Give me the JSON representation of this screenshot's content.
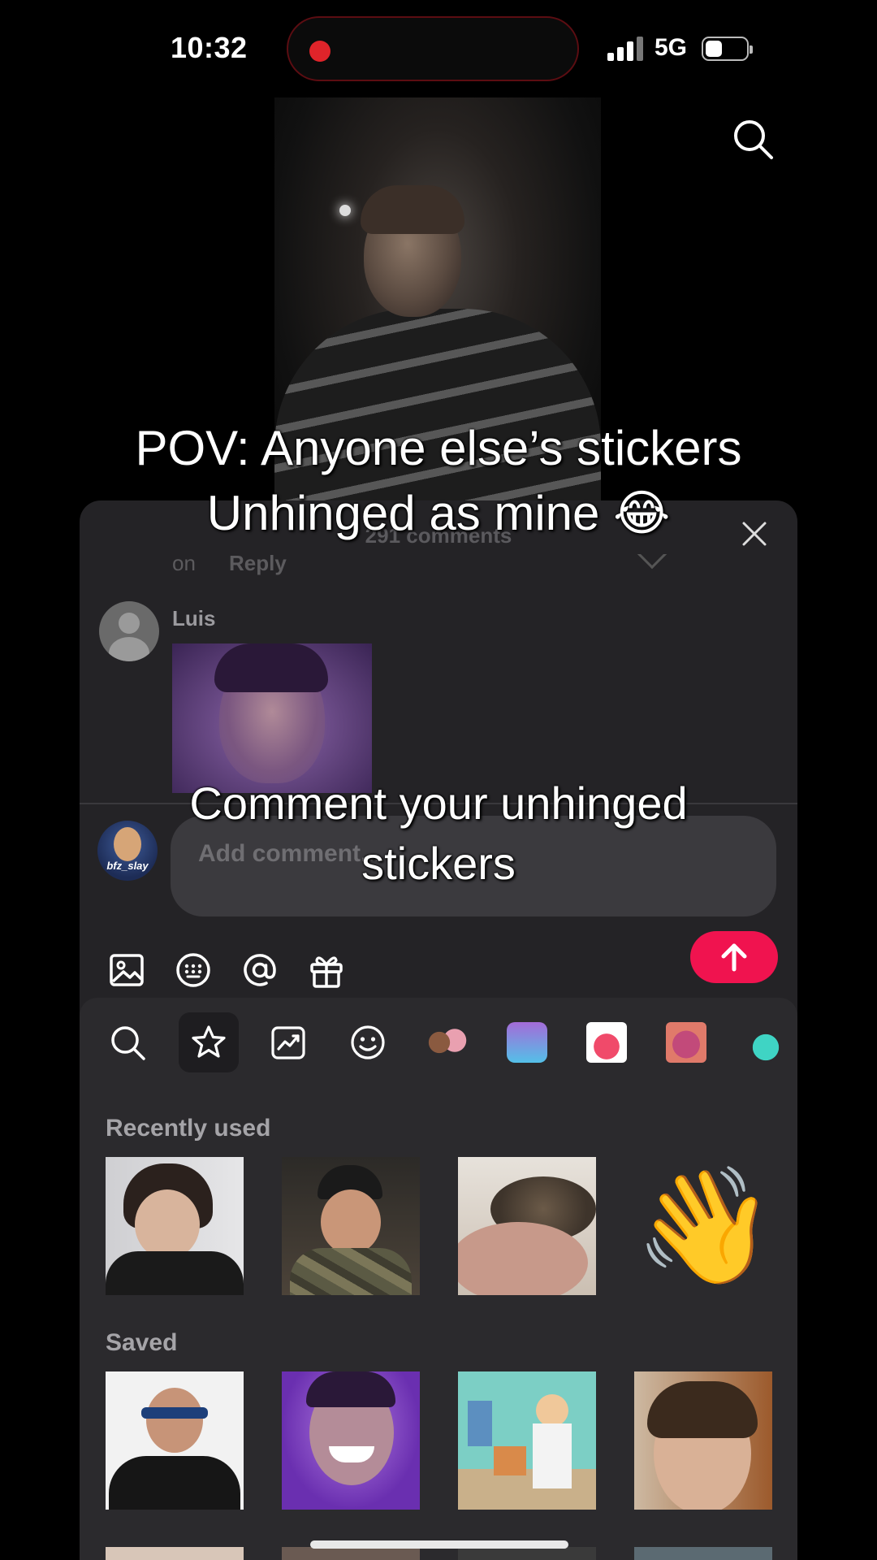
{
  "status_bar": {
    "time": "10:32",
    "network": "5G",
    "battery_level": 0.42,
    "signal_bars": 3,
    "screen_recording": true
  },
  "icons": {
    "top_search": "search-icon",
    "close": "close-icon",
    "image": "image-icon",
    "keyboard": "keyboard-icon",
    "mention": "at-icon",
    "gift": "gift-icon",
    "send": "arrow-up-icon"
  },
  "overlay": {
    "caption_top_line1": "POV: Anyone else’s stickers",
    "caption_top_line2": "Unhinged as mine 😂",
    "caption_bottom_line1": "Comment your unhinged",
    "caption_bottom_line2": "stickers"
  },
  "comments_sheet": {
    "count_label": "291 comments",
    "reply_prefix": "on",
    "reply_label": "Reply",
    "comment": {
      "username": "Luis"
    }
  },
  "composer": {
    "avatar_tag": "bfz_slay",
    "placeholder": "Add comment..."
  },
  "sticker_panel": {
    "recently_used_label": "Recently used",
    "saved_label": "Saved",
    "wave_emoji": "👋"
  },
  "colors": {
    "accent": "#f0134f",
    "sheet_bg": "#242326",
    "panel_bg": "#2b2a2d",
    "input_bg": "#3b3a3e"
  }
}
